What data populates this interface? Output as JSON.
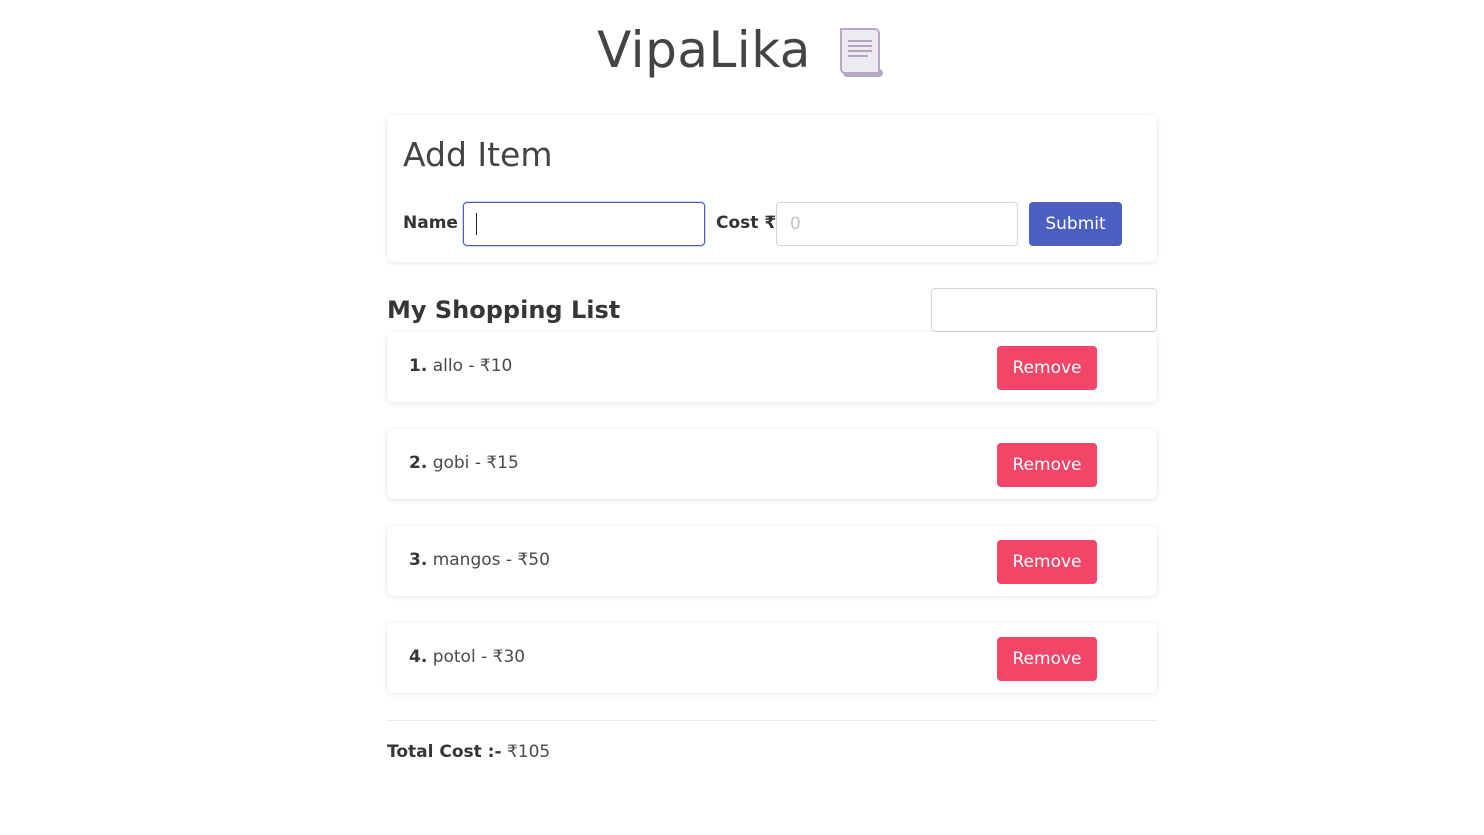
{
  "app": {
    "title": "VipaLika",
    "icon": "scroll-icon"
  },
  "add_item": {
    "heading": "Add Item",
    "name_label": "Name",
    "name_value": "",
    "cost_label": "Cost ₹",
    "cost_placeholder": "0",
    "submit_label": "Submit"
  },
  "shopping_list": {
    "heading": "My Shopping List",
    "search_value": "",
    "items": [
      {
        "number": "1.",
        "text": "allo - ₹10",
        "remove_label": "Remove"
      },
      {
        "number": "2.",
        "text": "gobi - ₹15",
        "remove_label": "Remove"
      },
      {
        "number": "3.",
        "text": "mangos - ₹50",
        "remove_label": "Remove"
      },
      {
        "number": "4.",
        "text": "potol - ₹30",
        "remove_label": "Remove"
      }
    ]
  },
  "total": {
    "label": "Total Cost :-",
    "value": "₹105"
  },
  "colors": {
    "primary": "#4a5fc1",
    "danger": "#f14668",
    "text": "#444444"
  }
}
